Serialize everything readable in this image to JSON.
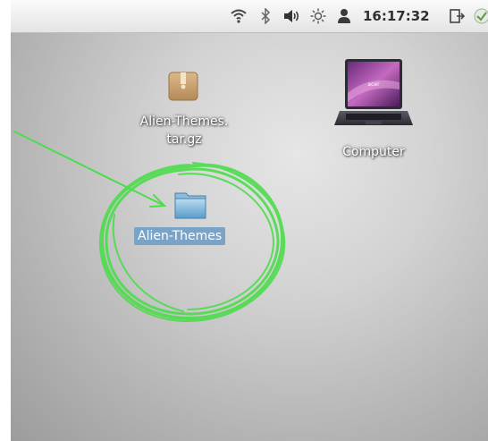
{
  "panel": {
    "clock": "16:17:32",
    "icons": [
      "wifi-icon",
      "bluetooth-icon",
      "volume-icon",
      "brightness-icon",
      "user-icon",
      "logout-icon",
      "update-icon"
    ]
  },
  "desktop": {
    "items": [
      {
        "label_line1": "Alien-Themes.",
        "label_line2": "tar.gz",
        "icon": "archive-package-icon"
      },
      {
        "label": "Computer",
        "icon": "laptop-icon"
      },
      {
        "label": "Alien-Themes",
        "icon": "folder-icon",
        "selected": true
      }
    ]
  },
  "annotation": {
    "color": "#4ddc4d",
    "marks": [
      "arrow",
      "circle"
    ]
  }
}
